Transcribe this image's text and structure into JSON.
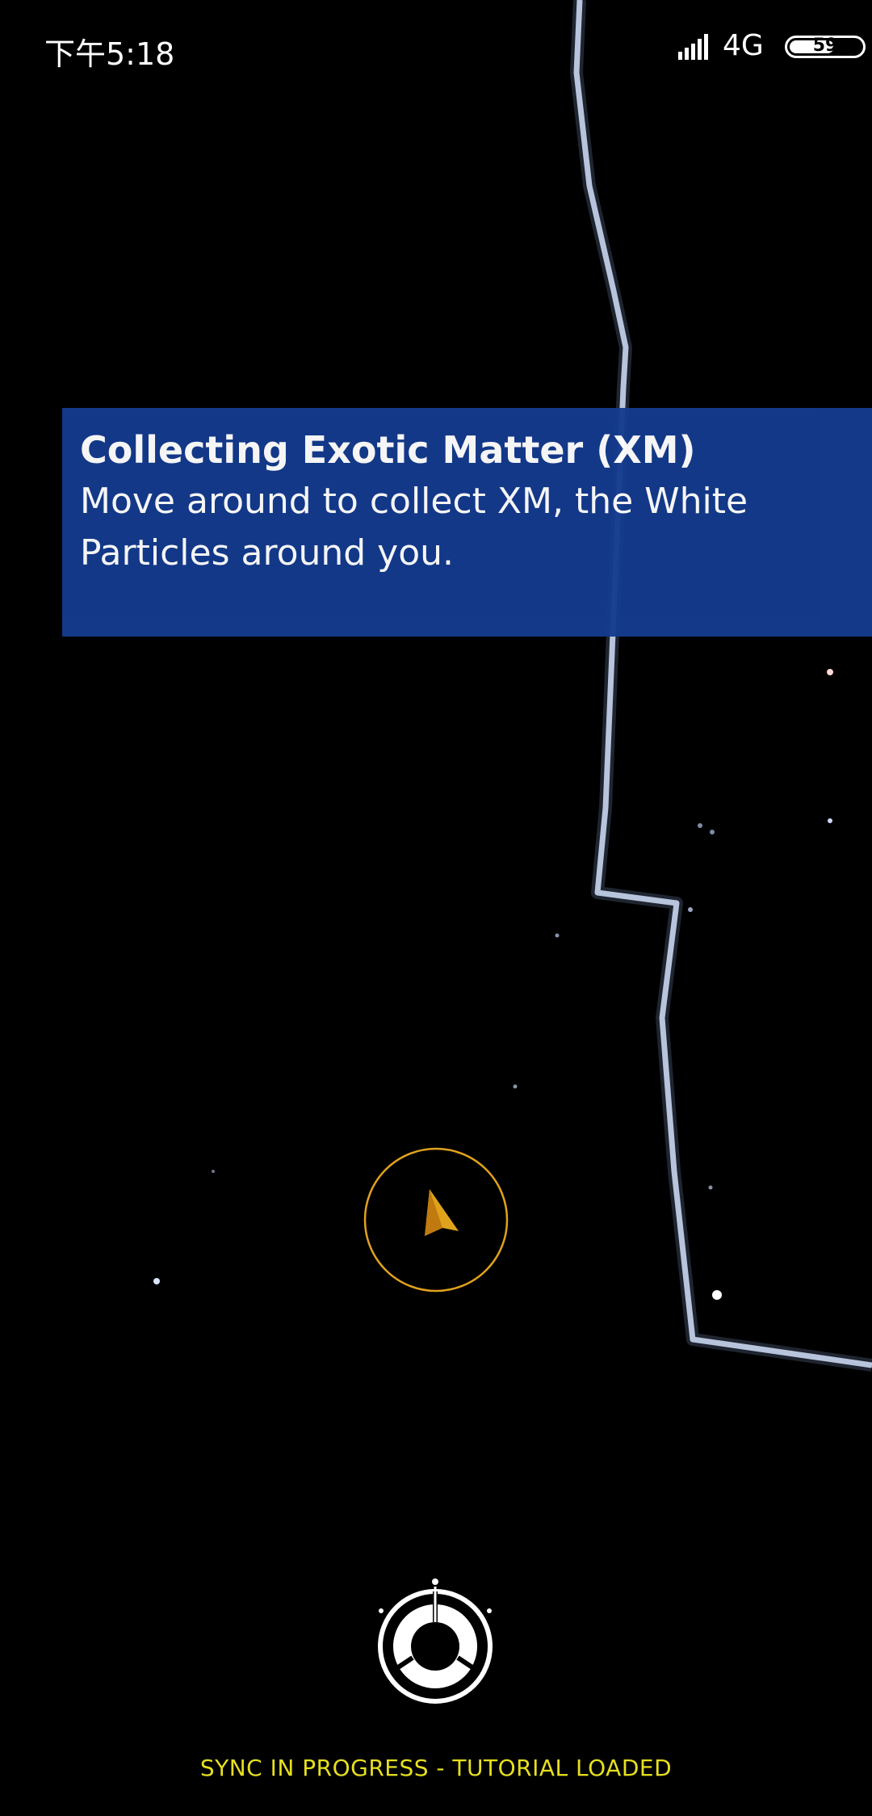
{
  "status_bar": {
    "time": "下午5:18",
    "network": "4G",
    "battery_level": "59",
    "battery_fraction": 0.59
  },
  "tutorial": {
    "title": "Collecting Exotic Matter (XM)",
    "body": "Move around to collect XM, the White Particles around you."
  },
  "footer": {
    "status": "SYNC IN PROGRESS - TUTORIAL LOADED"
  },
  "colors": {
    "tutorial_bg": "#143b8e",
    "player": "#e0a21d",
    "status_text": "#e6df1f",
    "road": "#b7c4dc"
  },
  "icons": {
    "player": "player-arrow-icon",
    "menu": "ops-menu-icon",
    "signal": "signal-bars-icon",
    "battery": "battery-icon"
  }
}
